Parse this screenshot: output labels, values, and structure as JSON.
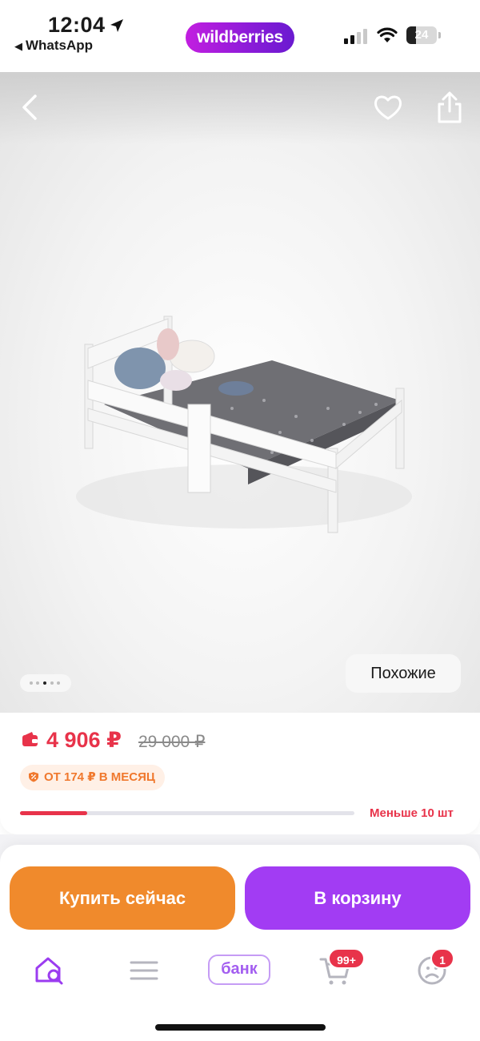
{
  "status_bar": {
    "time": "12:04",
    "back_app": "WhatsApp",
    "brand": "wildberries",
    "battery": "24",
    "icons": [
      "location-arrow-icon",
      "signal-icon",
      "wifi-icon",
      "battery-icon"
    ]
  },
  "product_image": {
    "icons": [
      "back-chevron-icon",
      "heart-icon",
      "share-icon"
    ],
    "pagination": {
      "total": 5,
      "active_index": 2
    },
    "similar_label": "Похожие"
  },
  "price_block": {
    "price": "4 906 ₽",
    "old_price": "29 000 ₽",
    "installment": "ОТ 174 ₽ В МЕСЯЦ",
    "stock_label": "Меньше 10 шт",
    "stock_level": 0.2
  },
  "actions": {
    "buy_now": "Купить сейчас",
    "add_to_cart": "В корзину"
  },
  "tab_bar": {
    "bank_label": "банк",
    "cart_badge": "99+",
    "profile_badge": "1",
    "icons": [
      "home-search-icon",
      "menu-icon",
      "cart-icon",
      "profile-icon"
    ]
  },
  "colors": {
    "brand_purple": "#a23cf3",
    "buy_orange": "#f08a2c",
    "price_red": "#e8334a"
  }
}
